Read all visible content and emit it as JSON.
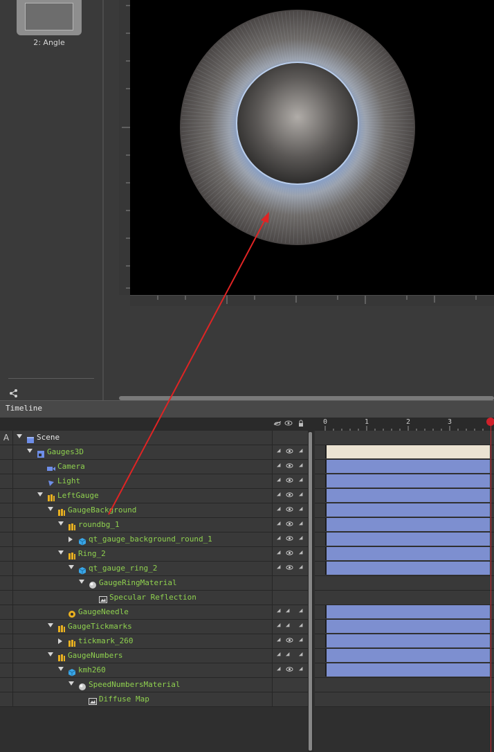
{
  "slides": {
    "slide_label": "2: Angle"
  },
  "timeline": {
    "title": "Timeline",
    "time_ticks": [
      "0",
      "1",
      "2",
      "3"
    ],
    "a_column_label": "A"
  },
  "tree_rows": [
    {
      "label": "Scene",
      "color": "#e6e6e6",
      "indent": 0,
      "arrow": "down",
      "icon": "scene-icon",
      "has_vis": false,
      "has_track": false
    },
    {
      "label": "Gauges3D",
      "color": "#8fd14f",
      "indent": 1,
      "arrow": "down",
      "icon": "layer-icon",
      "has_vis": true,
      "has_track": true,
      "selected": true
    },
    {
      "label": "Camera",
      "color": "#8fd14f",
      "indent": 2,
      "arrow": "none",
      "icon": "camera-icon",
      "has_vis": true,
      "has_track": true
    },
    {
      "label": "Light",
      "color": "#8fd14f",
      "indent": 2,
      "arrow": "none",
      "icon": "light-icon",
      "has_vis": true,
      "has_track": true
    },
    {
      "label": "LeftGauge",
      "color": "#8fd14f",
      "indent": 2,
      "arrow": "down",
      "icon": "group-icon",
      "has_vis": true,
      "has_track": true
    },
    {
      "label": "GaugeBackground",
      "color": "#8fd14f",
      "indent": 3,
      "arrow": "down",
      "icon": "group-icon",
      "has_vis": true,
      "has_track": true
    },
    {
      "label": "roundbg_1",
      "color": "#8fd14f",
      "indent": 4,
      "arrow": "down",
      "icon": "group-icon",
      "has_vis": true,
      "has_track": true
    },
    {
      "label": "qt_gauge_background_round_1",
      "color": "#8fd14f",
      "indent": 5,
      "arrow": "right",
      "icon": "model-icon",
      "has_vis": true,
      "has_track": true
    },
    {
      "label": "Ring_2",
      "color": "#8fd14f",
      "indent": 4,
      "arrow": "down",
      "icon": "group-icon",
      "has_vis": true,
      "has_track": true
    },
    {
      "label": "qt_gauge_ring_2",
      "color": "#8fd14f",
      "indent": 5,
      "arrow": "down",
      "icon": "model-icon",
      "has_vis": true,
      "has_track": true
    },
    {
      "label": "GaugeRingMaterial",
      "color": "#8fd14f",
      "indent": 6,
      "arrow": "down",
      "icon": "material-icon",
      "has_vis": false,
      "has_track": false
    },
    {
      "label": "Specular Reflection",
      "color": "#8fd14f",
      "indent": 7,
      "arrow": "none",
      "icon": "image-icon",
      "has_vis": false,
      "has_track": false
    },
    {
      "label": "GaugeNeedle",
      "color": "#8fd14f",
      "indent": 4,
      "arrow": "none",
      "icon": "component-icon",
      "has_vis": true,
      "has_track": true,
      "eye": false
    },
    {
      "label": "GaugeTickmarks",
      "color": "#8fd14f",
      "indent": 3,
      "arrow": "down",
      "icon": "group-icon",
      "has_vis": true,
      "has_track": true,
      "eye": false
    },
    {
      "label": "tickmark_260",
      "color": "#8fd14f",
      "indent": 4,
      "arrow": "right",
      "icon": "group-icon",
      "has_vis": true,
      "has_track": true
    },
    {
      "label": "GaugeNumbers",
      "color": "#8fd14f",
      "indent": 3,
      "arrow": "down",
      "icon": "group-icon",
      "has_vis": true,
      "has_track": true,
      "eye": false
    },
    {
      "label": "kmh260",
      "color": "#8fd14f",
      "indent": 4,
      "arrow": "down",
      "icon": "model-icon",
      "has_vis": true,
      "has_track": true
    },
    {
      "label": "SpeedNumbersMaterial",
      "color": "#8fd14f",
      "indent": 5,
      "arrow": "down",
      "icon": "material-icon",
      "has_vis": false,
      "has_track": false
    },
    {
      "label": "Diffuse Map",
      "color": "#8fd14f",
      "indent": 6,
      "arrow": "none",
      "icon": "image-icon",
      "has_vis": false,
      "has_track": false
    }
  ],
  "colors": {
    "track_bar": "#7d8fd0",
    "selected_track": "#ebe3d2",
    "playhead": "#c8252b",
    "annotation_arrow": "#e02424"
  }
}
